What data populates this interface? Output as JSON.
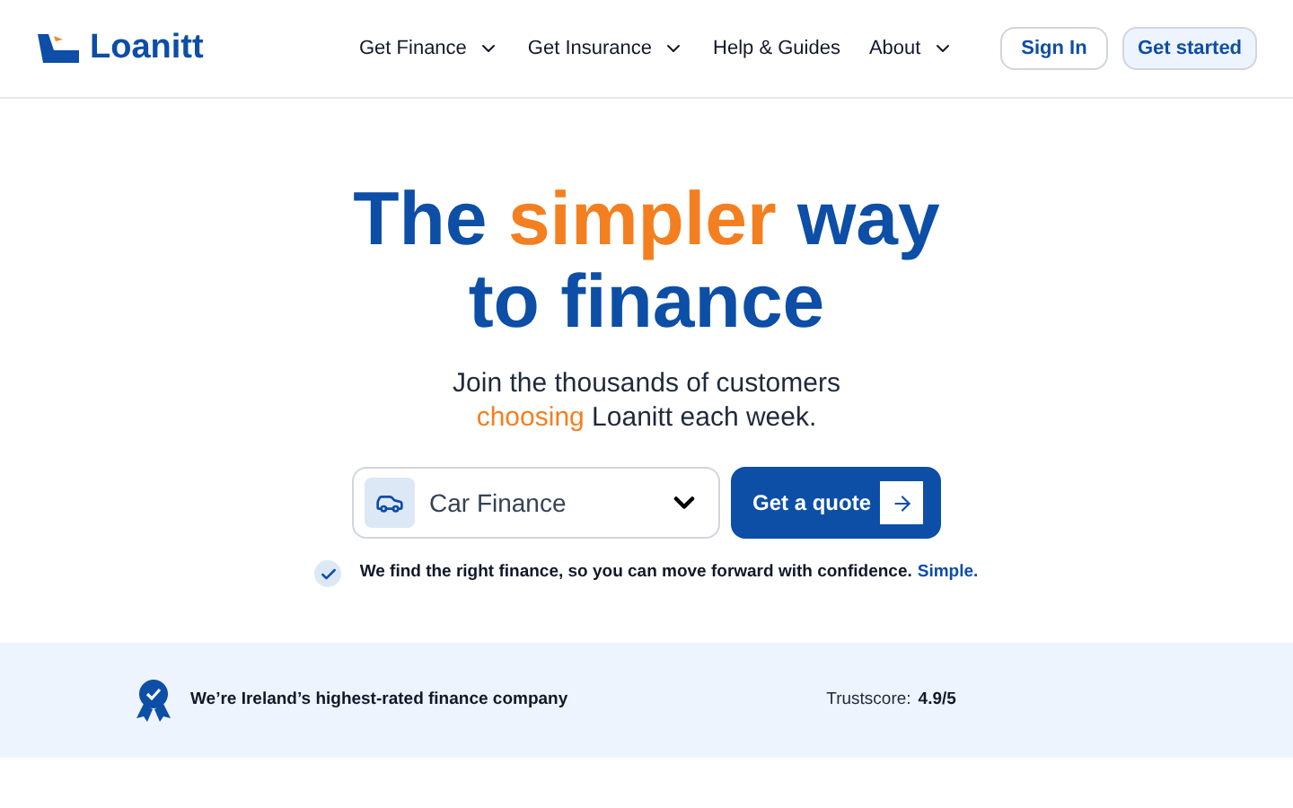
{
  "header": {
    "logo": "Loanitt",
    "nav": [
      {
        "label": "Get Finance",
        "dropdown": true
      },
      {
        "label": "Get Insurance",
        "dropdown": true
      },
      {
        "label": "Help & Guides",
        "dropdown": false
      },
      {
        "label": "About",
        "dropdown": true
      }
    ],
    "buttons": [
      {
        "label": "Sign In",
        "kind": "outline"
      },
      {
        "label": "Get started",
        "kind": "tinted"
      }
    ]
  },
  "hero": {
    "title": [
      {
        "text": "The ",
        "accent": false
      },
      {
        "text": "simpler",
        "accent": true
      },
      {
        "text": " way to finance",
        "accent": false
      }
    ],
    "subtitle": [
      {
        "text": "Join the thousands of customers ",
        "accent": false
      },
      {
        "text": "choosing",
        "accent": true
      },
      {
        "text": " Loanitt each week.",
        "accent": false
      }
    ],
    "select": {
      "value": "Car Finance"
    },
    "cta": "Get a quote",
    "note": {
      "text": "We find the right finance, so you can move forward with confidence.",
      "link": "Simple."
    }
  },
  "trust_band": {
    "claim": "We’re Ireland’s highest-rated finance company",
    "score_label": "Trustscore:",
    "score": "4.9/5"
  }
}
